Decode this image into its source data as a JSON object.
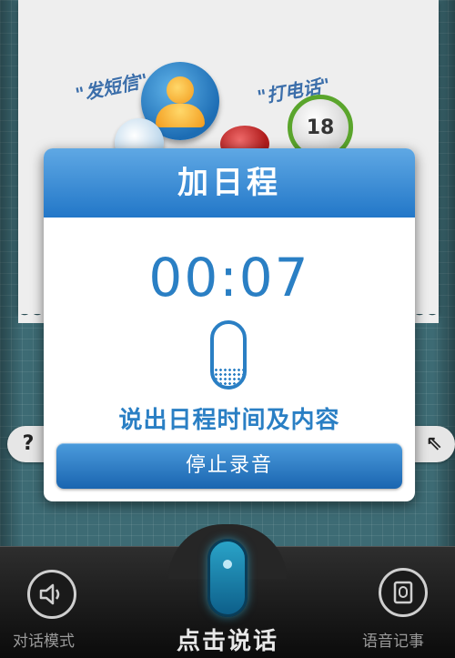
{
  "background": {
    "bubbles": {
      "sms": "\"发短信\"",
      "call": "\"打电话\""
    },
    "calendar_number": "18"
  },
  "dialog": {
    "title": "加日程",
    "timer": "00:07",
    "prompt": "说出日程时间及内容",
    "stop_label": "停止录音",
    "mic_level": 0.3
  },
  "side_buttons": {
    "help": "?",
    "expand": "⇖"
  },
  "bottom_bar": {
    "dialog_mode_label": "对话模式",
    "talk_label": "点击说话",
    "voice_memo_label": "语音记事"
  },
  "colors": {
    "accent": "#2a7fc4",
    "header": "#2277c8",
    "background": "#3d6b74"
  }
}
